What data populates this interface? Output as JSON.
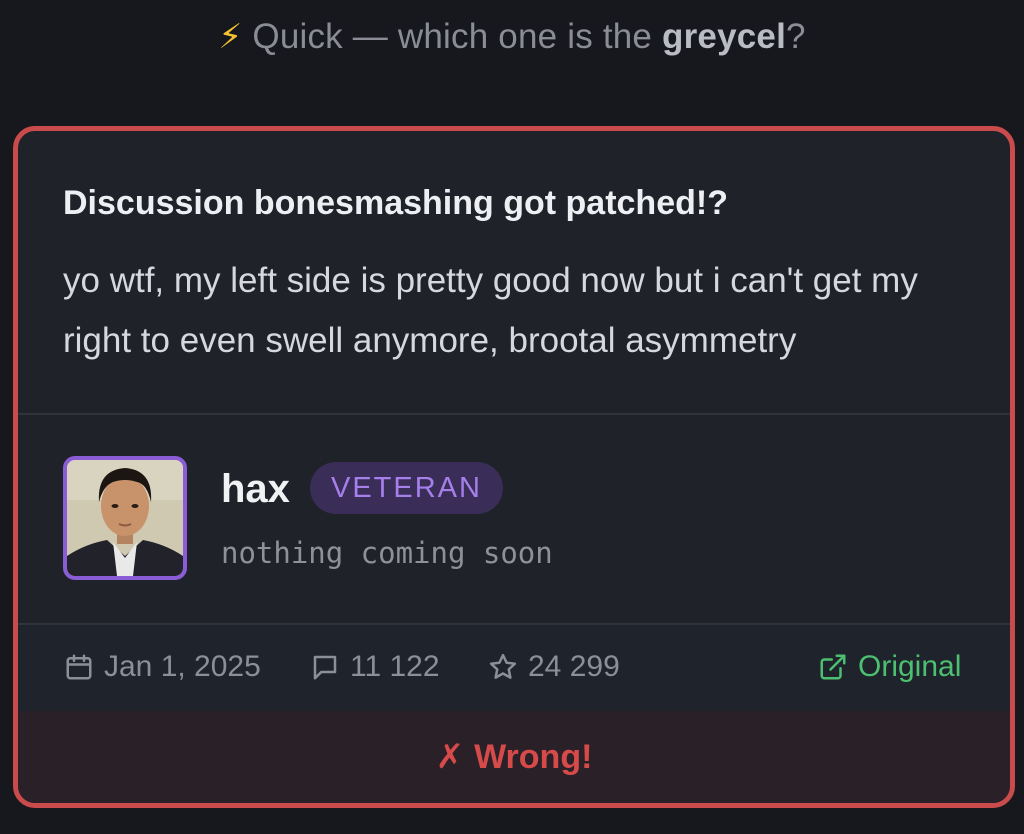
{
  "prompt": {
    "icon": "lightning-icon",
    "prefix": "Quick — which one is the ",
    "emphasis": "greycel",
    "suffix": "?"
  },
  "post": {
    "title": "Discussion bonesmashing got patched!?",
    "body": "yo wtf, my left side is pretty good now but i can't get my right to even swell anymore, brootal asymmetry"
  },
  "author": {
    "username": "hax",
    "badge": "VETERAN",
    "tagline": "nothing coming soon"
  },
  "meta": {
    "date": "Jan 1, 2025",
    "comments": "11 122",
    "stars": "24 299",
    "original_label": "Original"
  },
  "verdict": {
    "mark": "✗",
    "label": "Wrong!"
  },
  "colors": {
    "background": "#17181d",
    "card": "#20222a",
    "card_border": "#c94b4b",
    "badge_bg": "#3a2e58",
    "badge_text": "#a57fea",
    "avatar_border": "#8a5cd6",
    "original_link": "#4cc070",
    "wrong": "#d64a4a",
    "lightning": "#f2c230"
  }
}
